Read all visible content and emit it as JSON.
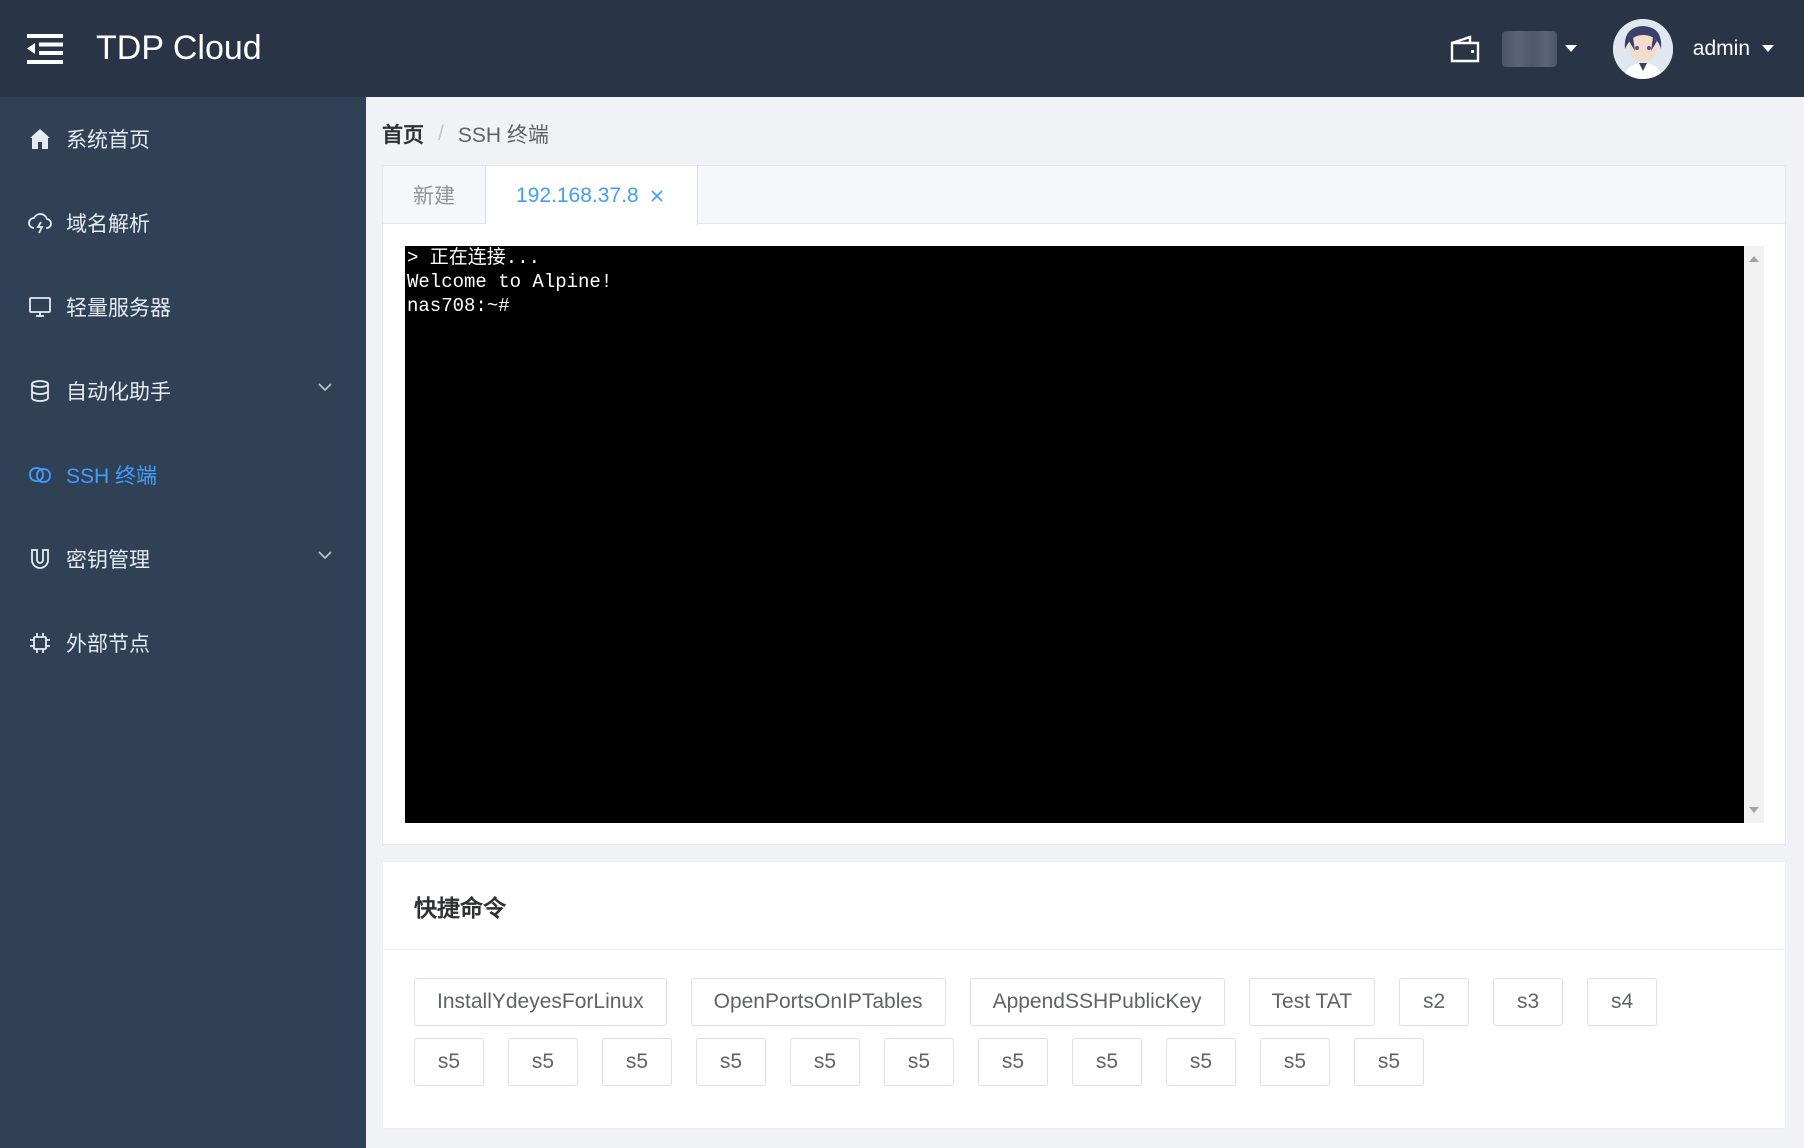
{
  "header": {
    "app_title": "TDP Cloud",
    "user_name": "admin"
  },
  "sidebar": {
    "items": [
      {
        "label": "系统首页",
        "icon": "home-icon"
      },
      {
        "label": "域名解析",
        "icon": "cloud-lightning-icon"
      },
      {
        "label": "轻量服务器",
        "icon": "monitor-icon"
      },
      {
        "label": "自动化助手",
        "icon": "database-icon",
        "expandable": true
      },
      {
        "label": "SSH 终端",
        "icon": "link-icon",
        "active": true
      },
      {
        "label": "密钥管理",
        "icon": "magnet-icon",
        "expandable": true
      },
      {
        "label": "外部节点",
        "icon": "cpu-icon"
      }
    ]
  },
  "breadcrumb": {
    "home": "首页",
    "separator": "/",
    "current": "SSH 终端"
  },
  "tabs": [
    {
      "label": "新建"
    },
    {
      "label": "192.168.37.8",
      "active": true
    }
  ],
  "terminal": {
    "lines": [
      "> 正在连接...",
      "Welcome to Alpine!",
      "nas708:~#"
    ]
  },
  "quick_commands": {
    "title": "快捷命令",
    "row1": [
      "InstallYdeyesForLinux",
      "OpenPortsOnIPTables",
      "AppendSSHPublicKey",
      "Test TAT",
      "s2",
      "s3",
      "s4"
    ],
    "row2": [
      "s5",
      "s5",
      "s5",
      "s5",
      "s5",
      "s5",
      "s5",
      "s5",
      "s5",
      "s5",
      "s5"
    ]
  },
  "colors": {
    "header_bg": "#2a3447",
    "sidebar_bg": "#304156",
    "accent": "#409eff"
  }
}
